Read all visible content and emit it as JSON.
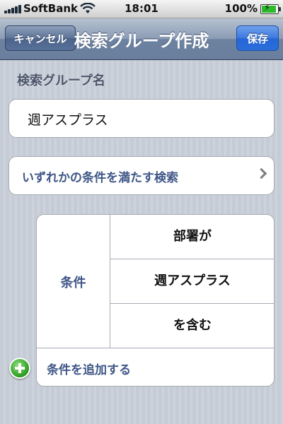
{
  "status_bar": {
    "carrier": "SoftBank",
    "time": "18:01",
    "battery_percent": "100%",
    "battery_level": 1.0,
    "icons": [
      "signal-icon",
      "wifi-icon",
      "battery-charging-icon"
    ]
  },
  "nav": {
    "title": "検索グループ作成",
    "cancel_label": "キャンセル",
    "save_label": "保存"
  },
  "form": {
    "group_name_label": "検索グループ名",
    "group_name_value": "週アスプラス",
    "match_mode": "いずれかの条件を満たす検索",
    "condition": {
      "label": "条件",
      "field": "部署が",
      "value": "週アスプラス",
      "operator": "を含む"
    },
    "add_condition_label": "条件を追加する"
  },
  "colors": {
    "nav_gradient_top": "#b7c2d2",
    "nav_gradient_bottom": "#6a7f9e",
    "save_button": "#2566d6",
    "label_blue": "#3f5687",
    "add_icon_green": "#2b9a1e",
    "background": "#c6ccd6"
  }
}
